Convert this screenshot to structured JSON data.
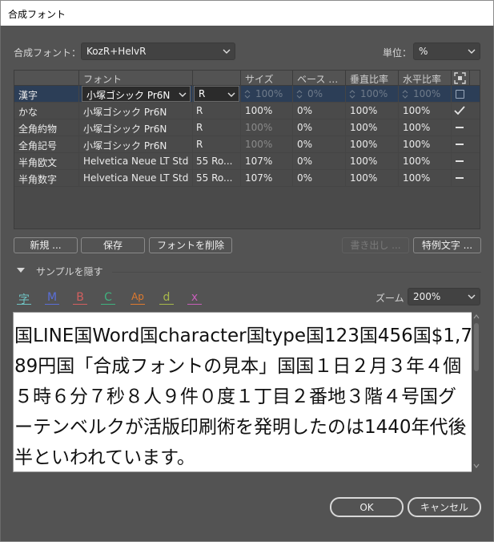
{
  "window": {
    "title": "合成フォント"
  },
  "composite_font": {
    "label": "合成フォント：",
    "value": "KozR+HelvR"
  },
  "units": {
    "label": "単位：",
    "value": "%"
  },
  "table": {
    "headers": {
      "font": "フォント",
      "size": "サイズ",
      "baseline": "ベース …",
      "vscale": "垂直比率",
      "hscale": "水平比率"
    },
    "rows": [
      {
        "name": "漢字",
        "font": "小塚ゴシック Pr6N",
        "style": "R",
        "size": "100%",
        "baseline": "0%",
        "vscale": "100%",
        "hscale": "100%",
        "mark": "checkbox",
        "selected": true
      },
      {
        "name": "かな",
        "font": "小塚ゴシック Pr6N",
        "style": "R",
        "size": "100%",
        "baseline": "0%",
        "vscale": "100%",
        "hscale": "100%",
        "mark": "check",
        "selected": false
      },
      {
        "name": "全角約物",
        "font": "小塚ゴシック Pr6N",
        "style": "R",
        "size": "100%",
        "baseline": "0%",
        "vscale": "100%",
        "hscale": "100%",
        "mark": "dash",
        "selected": false
      },
      {
        "name": "全角記号",
        "font": "小塚ゴシック Pr6N",
        "style": "R",
        "size": "100%",
        "baseline": "0%",
        "vscale": "100%",
        "hscale": "100%",
        "mark": "dash",
        "selected": false
      },
      {
        "name": "半角欧文",
        "font": "Helvetica Neue LT Std",
        "style": "55 Ro...",
        "size": "107%",
        "baseline": "0%",
        "vscale": "100%",
        "hscale": "100%",
        "mark": "dash",
        "selected": false
      },
      {
        "name": "半角数字",
        "font": "Helvetica Neue LT Std",
        "style": "55 Ro...",
        "size": "107%",
        "baseline": "0%",
        "vscale": "100%",
        "hscale": "100%",
        "mark": "dash",
        "selected": false
      }
    ]
  },
  "buttons": {
    "new": "新規 ...",
    "save": "保存",
    "delete_font": "フォントを削除",
    "export": "書き出し ...",
    "exceptions": "特例文字 ...",
    "ok": "OK",
    "cancel": "キャンセル"
  },
  "sample": {
    "toggle_label": "サンプルを隠す"
  },
  "guides": [
    {
      "glyph": "字",
      "color": "#6fc3c3"
    },
    {
      "glyph": "M",
      "color": "#5a6fd8"
    },
    {
      "glyph": "B",
      "color": "#d35f5f"
    },
    {
      "glyph": "C",
      "color": "#3fb27f"
    },
    {
      "glyph": "Ap",
      "color": "#e07a2e"
    },
    {
      "glyph": "d",
      "color": "#a7b84a"
    },
    {
      "glyph": "x",
      "color": "#c65fb8"
    }
  ],
  "zoom": {
    "label": "ズーム",
    "value": "200%"
  },
  "preview_text": "国LINE国Word国character国type国123国456国$1,789円国「合成フォントの見本」国国１日２月３年４個５時６分７秒８人９件０度１丁目２番地３階４号国グーテンベルクが活版印刷術を発明したのは1440年代後半といわれています。"
}
